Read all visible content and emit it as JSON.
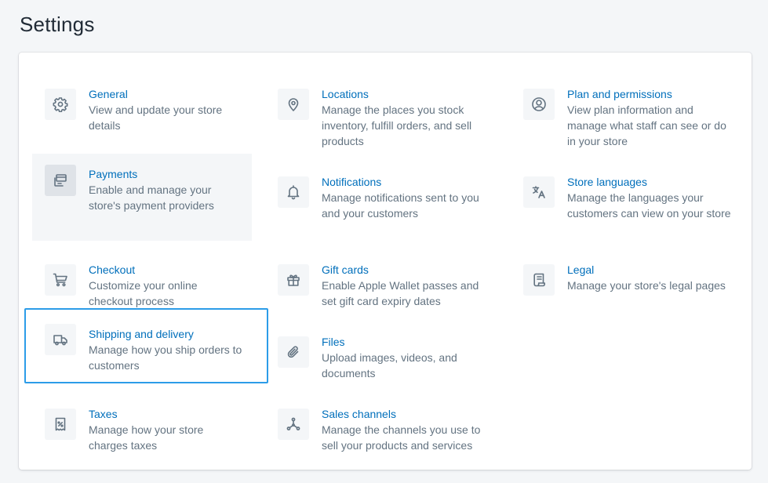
{
  "page": {
    "title": "Settings"
  },
  "settings": {
    "items": [
      {
        "key": "general",
        "title": "General",
        "description": "View and update your store details",
        "icon": "gear-icon"
      },
      {
        "key": "locations",
        "title": "Locations",
        "description": "Manage the places you stock inventory, fulfill orders, and sell products",
        "icon": "location-pin-icon"
      },
      {
        "key": "plan",
        "title": "Plan and permissions",
        "description": "View plan information and manage what staff can see or do in your store",
        "icon": "user-circle-icon"
      },
      {
        "key": "payments",
        "title": "Payments",
        "description": "Enable and manage your store's payment providers",
        "icon": "payment-icon"
      },
      {
        "key": "notifications",
        "title": "Notifications",
        "description": "Manage notifications sent to you and your customers",
        "icon": "bell-icon"
      },
      {
        "key": "languages",
        "title": "Store languages",
        "description": "Manage the languages your customers can view on your store",
        "icon": "translate-icon"
      },
      {
        "key": "checkout",
        "title": "Checkout",
        "description": "Customize your online checkout process",
        "icon": "cart-icon"
      },
      {
        "key": "giftcards",
        "title": "Gift cards",
        "description": "Enable Apple Wallet passes and set gift card expiry dates",
        "icon": "gift-icon"
      },
      {
        "key": "legal",
        "title": "Legal",
        "description": "Manage your store's legal pages",
        "icon": "legal-scroll-icon"
      },
      {
        "key": "shipping",
        "title": "Shipping and delivery",
        "description": "Manage how you ship orders to customers",
        "icon": "truck-icon"
      },
      {
        "key": "files",
        "title": "Files",
        "description": "Upload images, videos, and documents",
        "icon": "paperclip-icon"
      },
      {
        "key": "taxes",
        "title": "Taxes",
        "description": "Manage how your store charges taxes",
        "icon": "tax-receipt-icon"
      },
      {
        "key": "saleschannels",
        "title": "Sales channels",
        "description": "Manage the channels you use to sell your products and services",
        "icon": "sales-channels-icon"
      }
    ]
  }
}
